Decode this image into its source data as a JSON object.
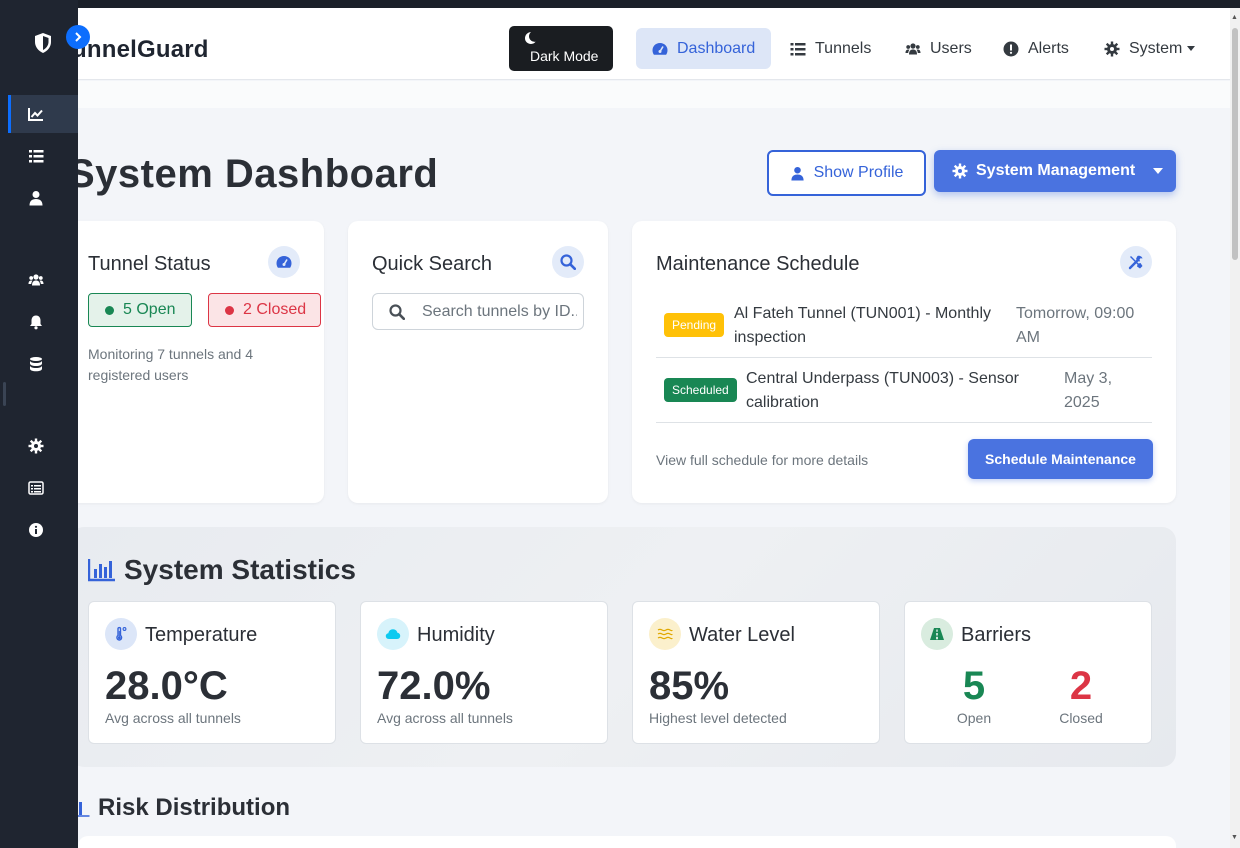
{
  "brand": {
    "name": "unnelGuard"
  },
  "navbar": {
    "dark_mode_label": "Dark Mode",
    "links": [
      {
        "label": "Dashboard",
        "icon": "gauge-icon",
        "active": true
      },
      {
        "label": "Tunnels",
        "icon": "list-icon"
      },
      {
        "label": "Users",
        "icon": "users-icon"
      },
      {
        "label": "Alerts",
        "icon": "exclamation-circle-icon"
      },
      {
        "label": "System",
        "icon": "gear-icon",
        "dropdown": true
      }
    ]
  },
  "sidebar": {
    "items": [
      {
        "icon": "chart-line-icon",
        "active": true
      },
      {
        "icon": "list-icon"
      },
      {
        "icon": "user-icon"
      },
      {
        "icon": "users-icon"
      },
      {
        "icon": "bell-icon"
      },
      {
        "icon": "database-icon"
      },
      {
        "icon": "gear-icon"
      },
      {
        "icon": "table-list-icon"
      },
      {
        "icon": "info-circle-icon"
      }
    ]
  },
  "page": {
    "title": "System Dashboard",
    "show_profile_label": "Show Profile",
    "system_management_label": "System Management"
  },
  "tunnel_status": {
    "title": "Tunnel Status",
    "open_label": "5 Open",
    "closed_label": "2 Closed",
    "monitoring_text": "Monitoring 7 tunnels and 4 registered users"
  },
  "quick_search": {
    "title": "Quick Search",
    "placeholder": "Search tunnels by ID..."
  },
  "maintenance": {
    "title": "Maintenance Schedule",
    "items": [
      {
        "badge": "Pending",
        "text": "Al Fateh Tunnel (TUN001) - Monthly inspection",
        "time": "Tomorrow, 09:00 AM"
      },
      {
        "badge": "Scheduled",
        "text": "Central Underpass (TUN003) - Sensor calibration",
        "time": "May 3, 2025"
      }
    ],
    "footer_text": "View full schedule for more details",
    "button_label": "Schedule Maintenance"
  },
  "stats": {
    "title": "System Statistics",
    "temperature": {
      "label": "Temperature",
      "value": "28.0°C",
      "sub": "Avg across all tunnels"
    },
    "humidity": {
      "label": "Humidity",
      "value": "72.0%",
      "sub": "Avg across all tunnels"
    },
    "water": {
      "label": "Water Level",
      "value": "85%",
      "sub": "Highest level detected"
    },
    "barriers": {
      "label": "Barriers",
      "open_value": "5",
      "open_label": "Open",
      "closed_value": "2",
      "closed_label": "Closed"
    }
  },
  "risk": {
    "title": "Risk Distribution"
  },
  "colors": {
    "primary": "#4a73e0",
    "success": "#198754",
    "danger": "#dc3545",
    "warning": "#ffc107",
    "sidebar": "#1f2530"
  }
}
